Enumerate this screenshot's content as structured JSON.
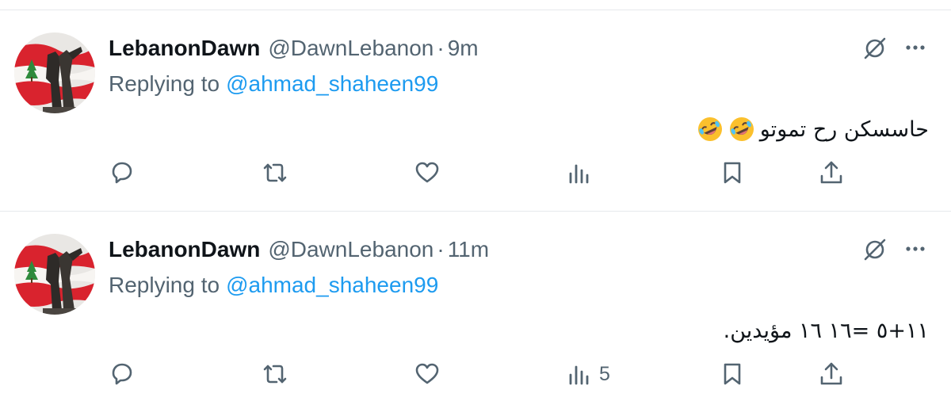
{
  "tweets": [
    {
      "display_name": "LebanonDawn",
      "handle": "@DawnLebanon",
      "separator": "·",
      "time": "9m",
      "replying_prefix": "Replying to",
      "replying_to": "@ahmad_shaheen99",
      "text": "حاسسكن رح تموتو",
      "emojis": [
        "rolling-on-floor-laughing-emoji",
        "rolling-on-floor-laughing-emoji"
      ],
      "views": ""
    },
    {
      "display_name": "LebanonDawn",
      "handle": "@DawnLebanon",
      "separator": "·",
      "time": "11m",
      "replying_prefix": "Replying to",
      "replying_to": "@ahmad_shaheen99",
      "text": "١١+٥ =١٦ ١٦ مؤيدين.",
      "emojis": [],
      "views": "5"
    }
  ],
  "colors": {
    "text_primary": "#0f1419",
    "text_secondary": "#536471",
    "accent": "#1d9bf0",
    "divider": "#e6e9ec",
    "flag_red": "#d9232e"
  }
}
